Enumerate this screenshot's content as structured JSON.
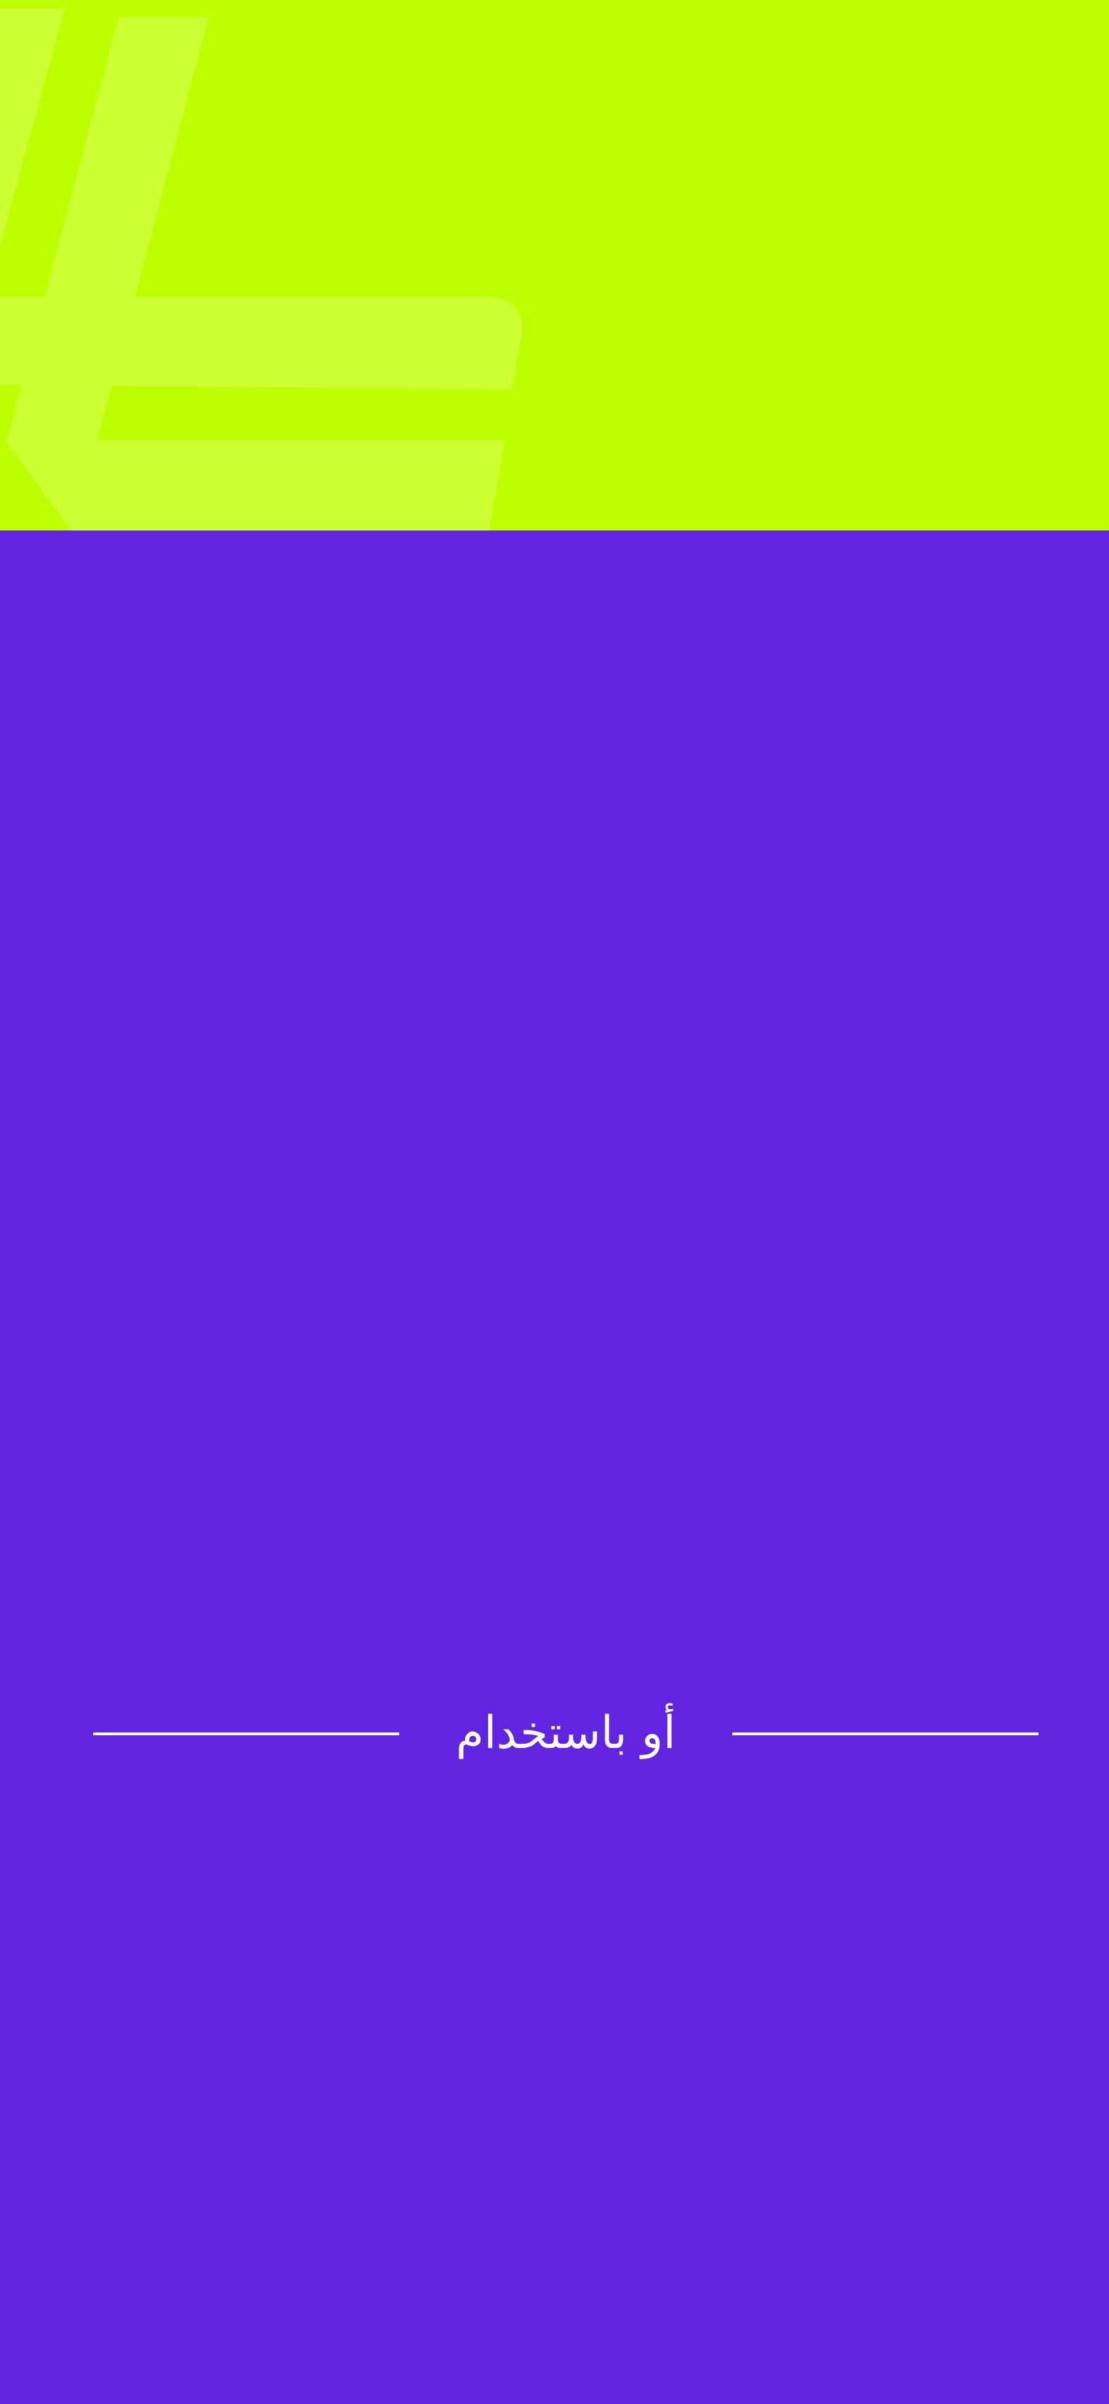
{
  "colors": {
    "hero_background": "#bcff00",
    "hero_logo_shape": "#cdff33",
    "main_background": "#6125e1",
    "divider_line": "#ffffff",
    "divider_text": "#ffffff"
  },
  "hero": {
    "decoration_icon": "brand-hash-logo-icon"
  },
  "divider": {
    "label": "أو باستخدام"
  }
}
